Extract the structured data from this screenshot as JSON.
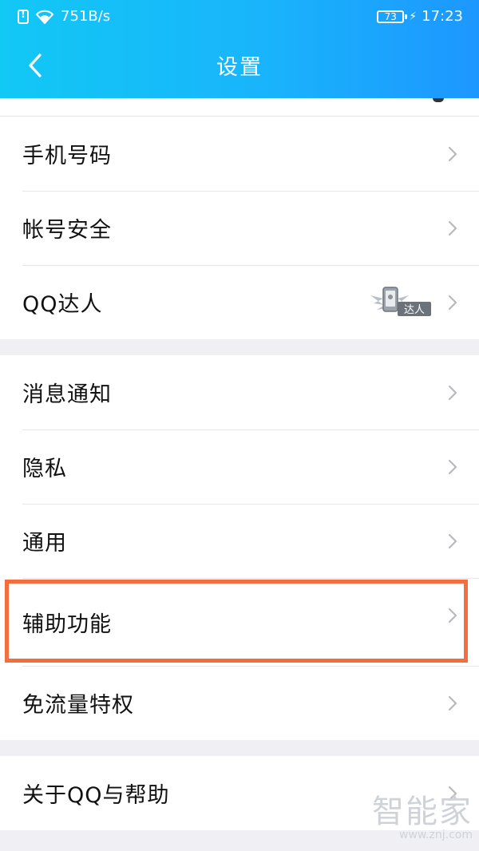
{
  "status_bar": {
    "speed": "751B/s",
    "battery": "73",
    "time": "17:23"
  },
  "header": {
    "title": "设置",
    "back_icon": "chevron-left-icon"
  },
  "groups": [
    {
      "items": [
        {
          "label": "手机号码"
        },
        {
          "label": "帐号安全"
        },
        {
          "label": "QQ达人",
          "badge": "达人"
        }
      ]
    },
    {
      "items": [
        {
          "label": "消息通知"
        },
        {
          "label": "隐私"
        },
        {
          "label": "通用"
        },
        {
          "label": "辅助功能",
          "highlighted": true
        },
        {
          "label": "免流量特权"
        }
      ]
    },
    {
      "items": [
        {
          "label": "关于QQ与帮助"
        }
      ]
    }
  ],
  "watermark": {
    "main": "智能家",
    "sub": "www.znj.com"
  },
  "colors": {
    "header_gradient_start": "#12c8f5",
    "header_gradient_end": "#1d97ff",
    "highlight_border": "#f36d3f",
    "background": "#efeff4"
  }
}
